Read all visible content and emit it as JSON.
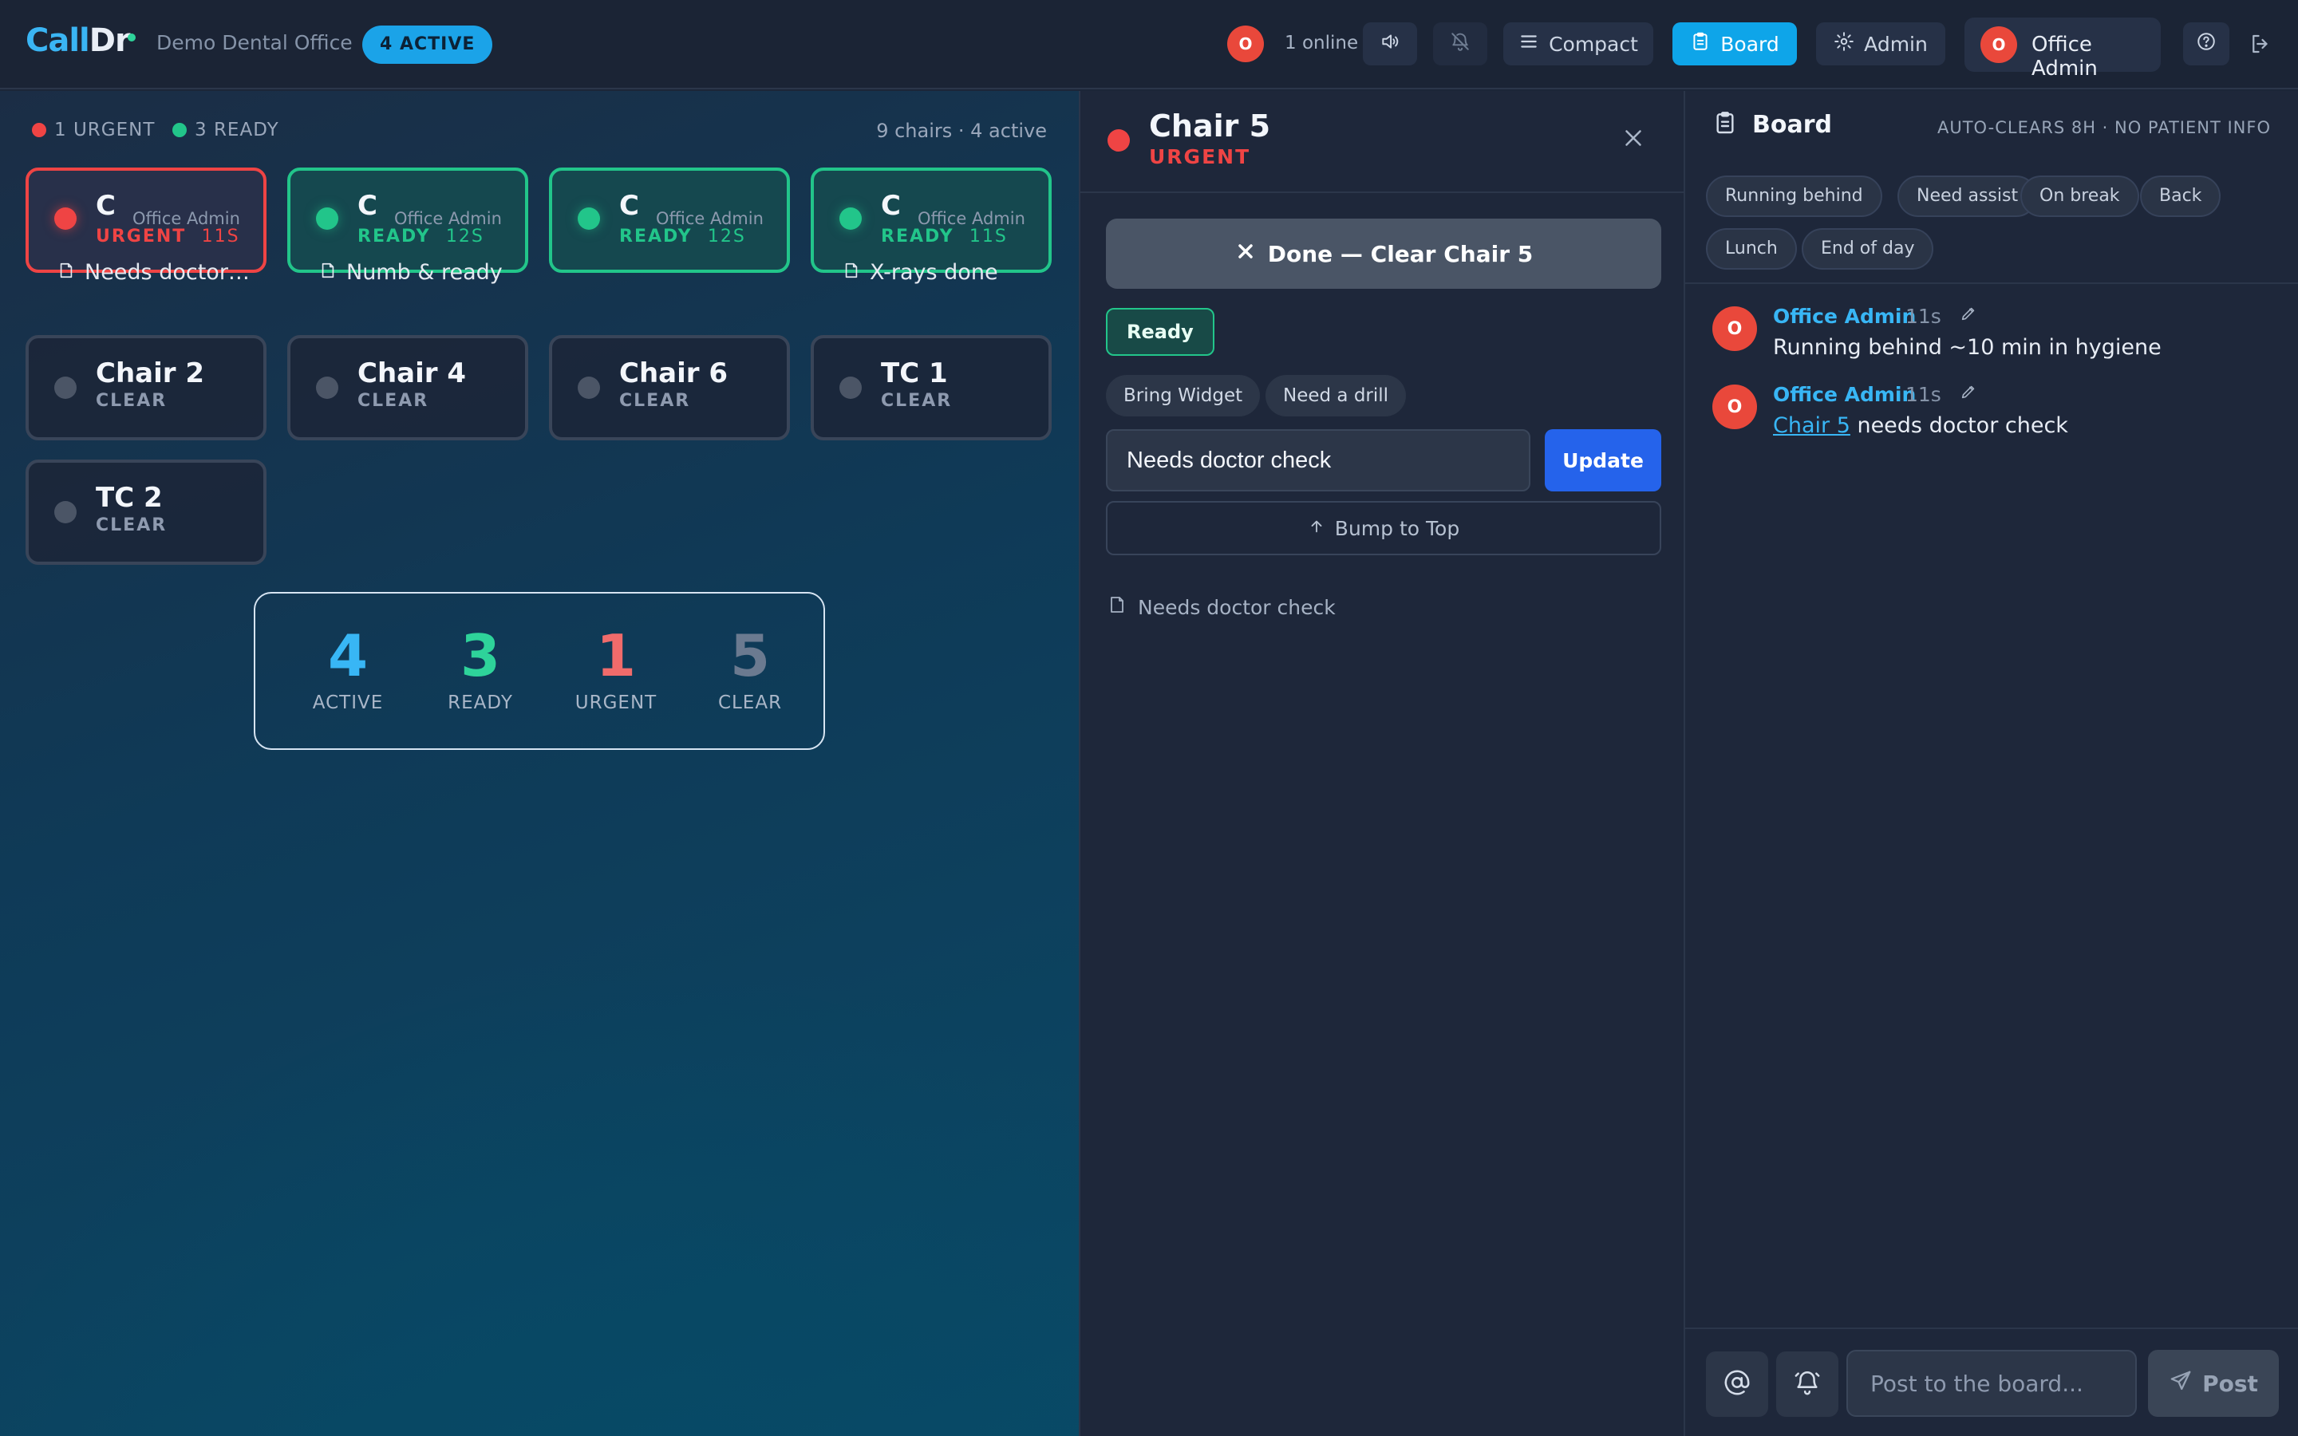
{
  "header": {
    "logo_part1": "Call",
    "logo_part2": "Dr",
    "office": "Demo Dental Office",
    "active_badge": "4 ACTIVE",
    "online_avatar": "O",
    "online_text": "1 online",
    "compact_label": "Compact",
    "board_label": "Board",
    "admin_label": "Admin",
    "user_avatar": "O",
    "user_name": "Office Admin"
  },
  "summary": {
    "urgent_label": "1 URGENT",
    "ready_label": "3 READY",
    "chairs_meta": "9 chairs · 4 active"
  },
  "cards": [
    {
      "name": "C",
      "by": "Office Admin",
      "status": "URGENT",
      "timer": "11S",
      "note": "Needs doctor…",
      "state": "urgent"
    },
    {
      "name": "C",
      "by": "Office Admin",
      "status": "READY",
      "timer": "12S",
      "note": "Numb & ready",
      "state": "ready"
    },
    {
      "name": "C",
      "by": "Office Admin",
      "status": "READY",
      "timer": "12S",
      "note": "",
      "state": "ready"
    },
    {
      "name": "C",
      "by": "Office Admin",
      "status": "READY",
      "timer": "11S",
      "note": "X-rays done",
      "state": "ready"
    },
    {
      "name": "Chair 2",
      "status": "CLEAR",
      "state": "clear"
    },
    {
      "name": "Chair 4",
      "status": "CLEAR",
      "state": "clear"
    },
    {
      "name": "Chair 6",
      "status": "CLEAR",
      "state": "clear"
    },
    {
      "name": "TC 1",
      "status": "CLEAR",
      "state": "clear"
    },
    {
      "name": "TC 2",
      "status": "CLEAR",
      "state": "clear"
    }
  ],
  "stats": [
    {
      "value": "4",
      "label": "ACTIVE",
      "color": "#38b6f5"
    },
    {
      "value": "3",
      "label": "READY",
      "color": "#2ed39a"
    },
    {
      "value": "1",
      "label": "URGENT",
      "color": "#f06b6b"
    },
    {
      "value": "5",
      "label": "CLEAR",
      "color": "#6b7a90"
    }
  ],
  "detail": {
    "title": "Chair 5",
    "status": "URGENT",
    "done_label": "Done — Clear Chair 5",
    "ready_label": "Ready",
    "chips": [
      "Bring Widget",
      "Need a drill"
    ],
    "note_value": "Needs doctor check",
    "update_label": "Update",
    "bump_label": "Bump to Top",
    "current_note": "Needs doctor check"
  },
  "board": {
    "title": "Board",
    "note": "AUTO-CLEARS 8H · NO PATIENT INFO",
    "chips": [
      "Running behind",
      "Need assist",
      "On break",
      "Back",
      "Lunch",
      "End of day"
    ],
    "messages": [
      {
        "avatar": "O",
        "author": "Office Admin",
        "time": "11s",
        "text": "Running behind ~10 min in hygiene"
      },
      {
        "avatar": "O",
        "author": "Office Admin",
        "time": "11s",
        "link": "Chair 5",
        "text": " needs doctor check"
      }
    ],
    "compose_placeholder": "Post to the board...",
    "post_label": "Post"
  },
  "colors": {
    "accent": "#0ea5e9",
    "urgent": "#ef4444",
    "ready": "#22c58a",
    "primary_button": "#2563eb"
  },
  "icons": [
    "speaker-icon",
    "bell-off-icon",
    "menu-icon",
    "clipboard-icon",
    "gear-icon",
    "help-icon",
    "logout-icon",
    "note-icon",
    "close-icon",
    "arrow-up-icon",
    "pencil-icon",
    "at-icon",
    "bell-ring-icon",
    "send-icon"
  ]
}
